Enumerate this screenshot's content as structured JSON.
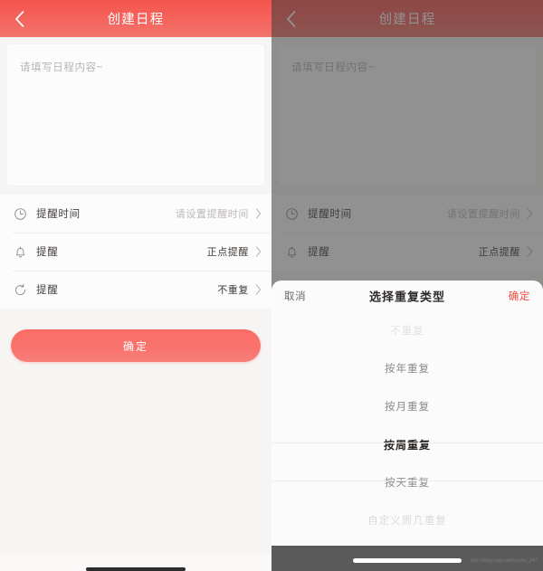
{
  "theme": {
    "brand_red": "#f4615a",
    "button_red": "#f9736d",
    "confirm_red": "#f04a42",
    "page_bg": "#f6f5f4",
    "card_bg": "#fdfcfc",
    "dim_overlay": "rgba(60,60,60,0.56)"
  },
  "left_panel": {
    "nav": {
      "back_icon": "chevron-left-icon",
      "title": "创建日程"
    },
    "note": {
      "placeholder": "请填写日程内容~",
      "value": ""
    },
    "rows": [
      {
        "icon": "clock-icon",
        "label": "提醒时间",
        "value": "请设置提醒时间",
        "value_muted": true,
        "chevron": "chevron-right-icon"
      },
      {
        "icon": "bell-icon",
        "label": "提醒",
        "value": "正点提醒",
        "value_muted": false,
        "chevron": "chevron-right-icon"
      },
      {
        "icon": "repeat-icon",
        "label": "提醒",
        "value": "不重复",
        "value_muted": false,
        "chevron": "chevron-right-icon"
      }
    ],
    "submit_label": "确定"
  },
  "right_panel": {
    "nav": {
      "back_icon": "chevron-left-icon",
      "title": "创建日程"
    },
    "note": {
      "placeholder": "请填写日程内容~",
      "value": ""
    },
    "rows": [
      {
        "icon": "clock-icon",
        "label": "提醒时间",
        "value": "请设置提醒时间",
        "value_muted": true,
        "chevron": "chevron-right-icon"
      },
      {
        "icon": "bell-icon",
        "label": "提醒",
        "value": "正点提醒",
        "value_muted": false,
        "chevron": "chevron-right-icon"
      }
    ],
    "sheet": {
      "cancel_label": "取消",
      "title": "选择重复类型",
      "confirm_label": "确定",
      "options": [
        "不重复",
        "按年重复",
        "按月重复",
        "按周重复",
        "按天重复",
        "自定义周几重复"
      ],
      "selected_index": 3,
      "selected_value": "按周重复"
    },
    "watermark": "http://blog.csdn.net/huchu_247"
  }
}
